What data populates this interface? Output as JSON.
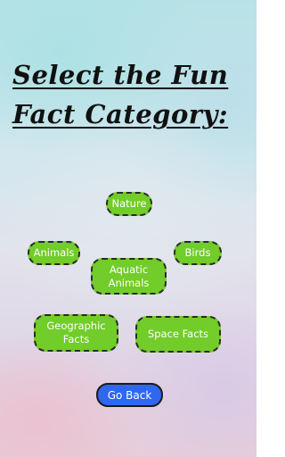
{
  "title": {
    "line1": "Select the Fun",
    "line2": "Fact Category:"
  },
  "categories": {
    "nature": "Nature",
    "animals": "Animals",
    "birds": "Birds",
    "aquatic_animals": "Aquatic Animals",
    "geographic_facts": "Geographic Facts",
    "space_facts": "Space Facts"
  },
  "go_back_label": "Go Back",
  "colors": {
    "category_button_bg": "#72cc2a",
    "category_button_border": "#2a2a2a",
    "go_back_bg": "#2f67ee",
    "title_text": "#111111"
  }
}
